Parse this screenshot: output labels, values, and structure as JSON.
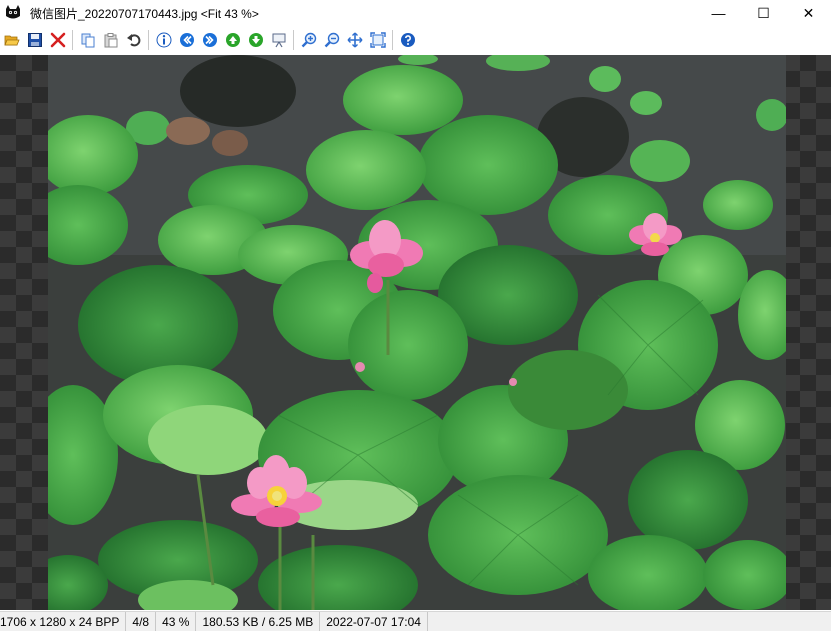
{
  "window": {
    "title": "微信图片_20220707170443.jpg <Fit 43 %>",
    "minimize_glyph": "—",
    "maximize_glyph": "☐",
    "close_glyph": "✕"
  },
  "toolbar": {
    "buttons": [
      {
        "name": "open-icon",
        "color": "#e5a823"
      },
      {
        "name": "save-icon",
        "color": "#1f4fa8"
      },
      {
        "name": "delete-icon",
        "color": "#d52020"
      },
      {
        "name": "copy-icon",
        "color": "#4a7fd0"
      },
      {
        "name": "paste-icon",
        "color": "#8a8a8a"
      },
      {
        "name": "undo-icon",
        "color": "#3a3a3a"
      },
      {
        "name": "info-icon",
        "color": "#1a5bbf"
      },
      {
        "name": "previous-icon",
        "color": "#1a6fd8"
      },
      {
        "name": "next-icon",
        "color": "#1a6fd8"
      },
      {
        "name": "move-up-icon",
        "color": "#2aa52a"
      },
      {
        "name": "move-down-icon",
        "color": "#2aa52a"
      },
      {
        "name": "slideshow-icon",
        "color": "#5a6a8a"
      },
      {
        "name": "zoom-in-icon",
        "color": "#2f6fcf"
      },
      {
        "name": "zoom-out-icon",
        "color": "#2f6fcf"
      },
      {
        "name": "fit-window-icon",
        "color": "#2f6fcf"
      },
      {
        "name": "full-screen-icon",
        "color": "#2f6fcf"
      },
      {
        "name": "help-icon",
        "color": "#1a5bbf"
      }
    ]
  },
  "image": {
    "subject": "pink lotus flowers among green lotus leaves on a pond"
  },
  "statusbar": {
    "dimensions": "1706 x 1280 x 24 BPP",
    "position": "4/8",
    "zoom": "43 %",
    "size": "180.53 KB / 6.25 MB",
    "date": "2022-07-07 17:04"
  }
}
